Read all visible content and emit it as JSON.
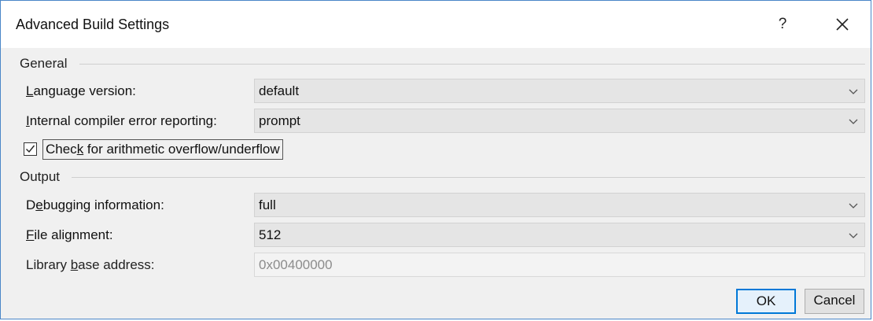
{
  "window": {
    "title": "Advanced Build Settings",
    "help_label": "?",
    "close_icon": "close-icon"
  },
  "general": {
    "header": "General",
    "language_version": {
      "label_pre": "",
      "label_access": "L",
      "label_post": "anguage version:",
      "value": "default"
    },
    "compiler_error_reporting": {
      "label_pre": "",
      "label_access": "I",
      "label_post": "nternal compiler error reporting:",
      "value": "prompt"
    },
    "overflow_check": {
      "label_pre": "Chec",
      "label_access": "k",
      "label_post": " for arithmetic overflow/underflow",
      "checked": true
    }
  },
  "output": {
    "header": "Output",
    "debugging_information": {
      "label_pre": "D",
      "label_access": "e",
      "label_post": "bugging information:",
      "value": "full"
    },
    "file_alignment": {
      "label_pre": "",
      "label_access": "F",
      "label_post": "ile alignment:",
      "value": "512"
    },
    "library_base_address": {
      "label_pre": "Library ",
      "label_access": "b",
      "label_post": "ase address:",
      "value": "0x00400000"
    }
  },
  "buttons": {
    "ok": "OK",
    "cancel": "Cancel"
  },
  "colors": {
    "window_border": "#4a86c8",
    "default_button_border": "#0078d7",
    "dialog_background": "#f0f0f0"
  }
}
